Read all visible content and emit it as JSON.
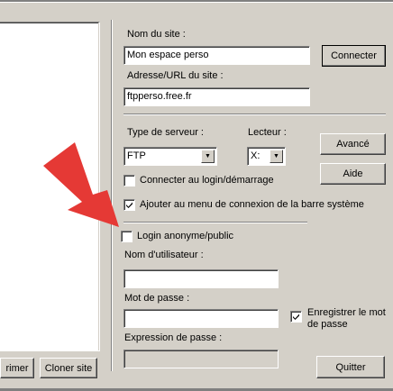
{
  "site_name": {
    "label": "Nom du site :",
    "value": "Mon espace perso"
  },
  "connect_button": "Connecter",
  "site_url": {
    "label": "Adresse/URL du site :",
    "value": "ftpperso.free.fr"
  },
  "server_type": {
    "label": "Type de serveur :",
    "value": "FTP"
  },
  "drive": {
    "label": "Lecteur :",
    "value": "X:"
  },
  "advanced_button": "Avancé",
  "help_button": "Aide",
  "connect_at_login": {
    "label": "Connecter au login/démarrage",
    "checked": false
  },
  "add_to_tray_menu": {
    "label": "Ajouter au menu de connexion de la barre système",
    "checked": true
  },
  "anonymous_login": {
    "label": "Login anonyme/public",
    "checked": false
  },
  "username": {
    "label": "Nom d'utilisateur :",
    "value": ""
  },
  "password": {
    "label": "Mot de passe :",
    "value": ""
  },
  "save_password": {
    "label_line1": "Enregistrer le mot",
    "label_line2": "de passe",
    "checked": true
  },
  "pass_expression": {
    "label": "Expression de passe :",
    "value": ""
  },
  "delete_button": "rimer",
  "clone_button": "Cloner site",
  "quit_button": "Quitter",
  "annotation_arrow": {
    "color": "#e53935"
  }
}
